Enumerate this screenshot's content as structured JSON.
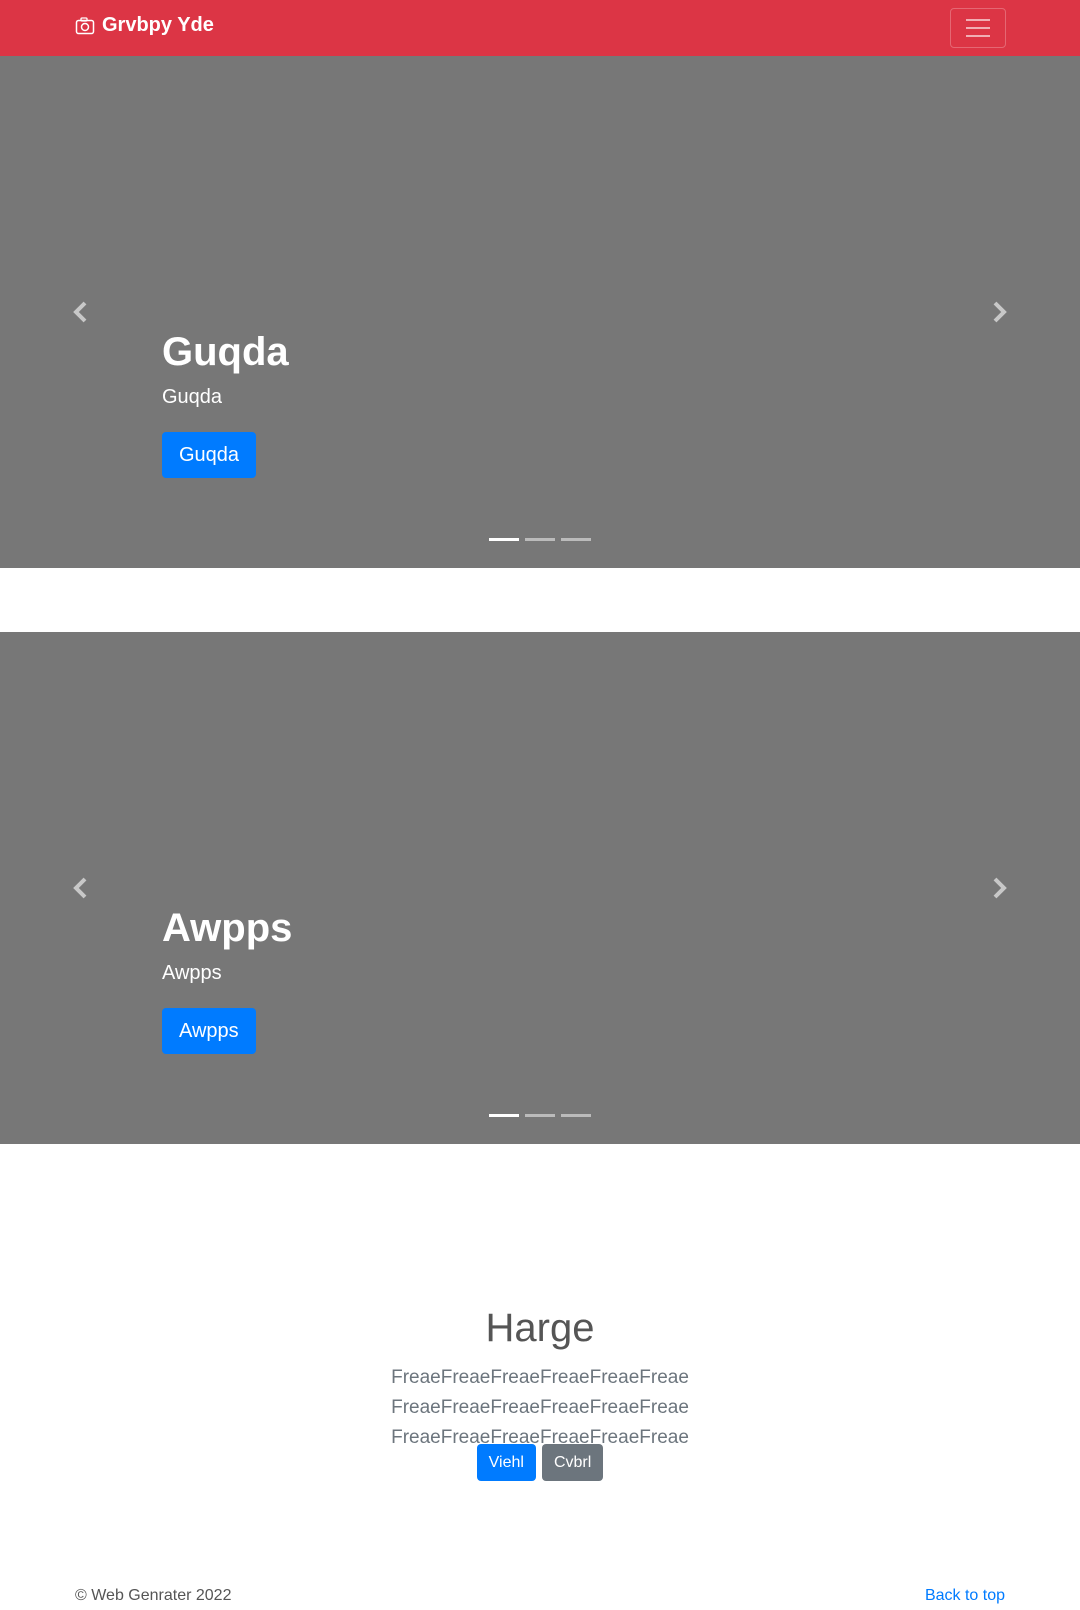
{
  "navbar": {
    "brand": "Grvbpy Yde",
    "color": "#dc3545"
  },
  "carousels": [
    {
      "title": "Guqda",
      "text": "Guqda",
      "button": "Guqda",
      "active_slide": 1,
      "slide_count": 3
    },
    {
      "title": "Awpps",
      "text": "Awpps",
      "button": "Awpps",
      "active_slide": 1,
      "slide_count": 3
    }
  ],
  "section": {
    "heading": "Harge",
    "lead": "FreaeFreaeFreaeFreaeFreaeFreae FreaeFreaeFreaeFreaeFreaeFreae FreaeFreaeFreaeFreaeFreaeFreae",
    "primary_button": "Viehl",
    "secondary_button": "Cvbrl"
  },
  "footer": {
    "copyright": "© Web Genrater 2022",
    "back_to_top": "Back to top"
  },
  "colors": {
    "primary": "#007bff",
    "secondary": "#6c757d",
    "carousel_bg": "#777777"
  }
}
